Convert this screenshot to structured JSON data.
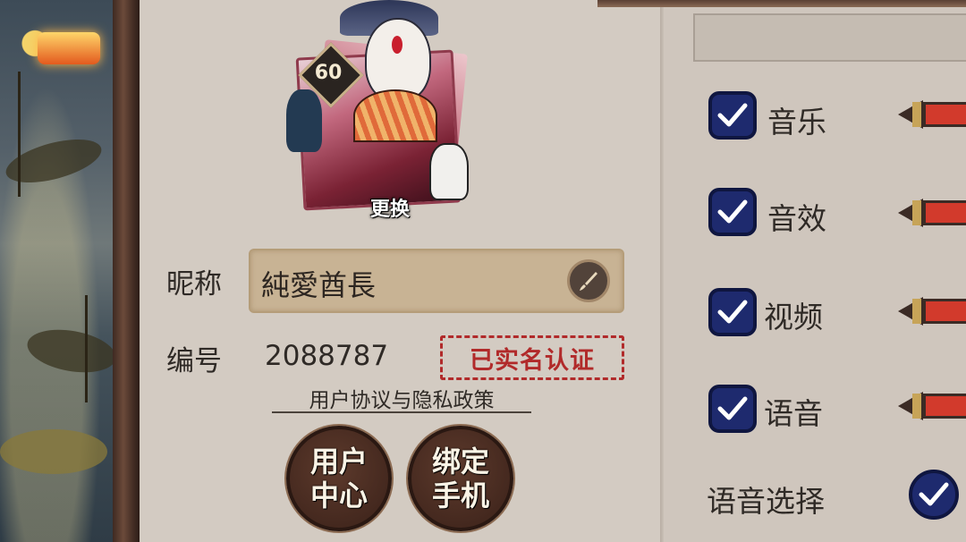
{
  "profile": {
    "level": "60",
    "change_avatar_label": "更换",
    "nickname_label": "昵称",
    "nickname_value": "純愛酋長",
    "id_label": "编号",
    "id_value": "2088787",
    "verified_stamp": "已实名认证",
    "policy_link": "用户协议与隐私政策",
    "user_center_line1": "用户",
    "user_center_line2": "中心",
    "bind_phone_line1": "绑定",
    "bind_phone_line2": "手机"
  },
  "settings": {
    "items": [
      {
        "label": "音乐",
        "checked": true
      },
      {
        "label": "音效",
        "checked": true
      },
      {
        "label": "视频",
        "checked": true
      },
      {
        "label": "语音",
        "checked": true
      }
    ],
    "voice_select_label": "语音选择"
  },
  "colors": {
    "checkbox": "#1e2a6e",
    "slider_fill": "#d23a2c",
    "stamp": "#b12a2a",
    "paper": "#d3cbc2"
  }
}
